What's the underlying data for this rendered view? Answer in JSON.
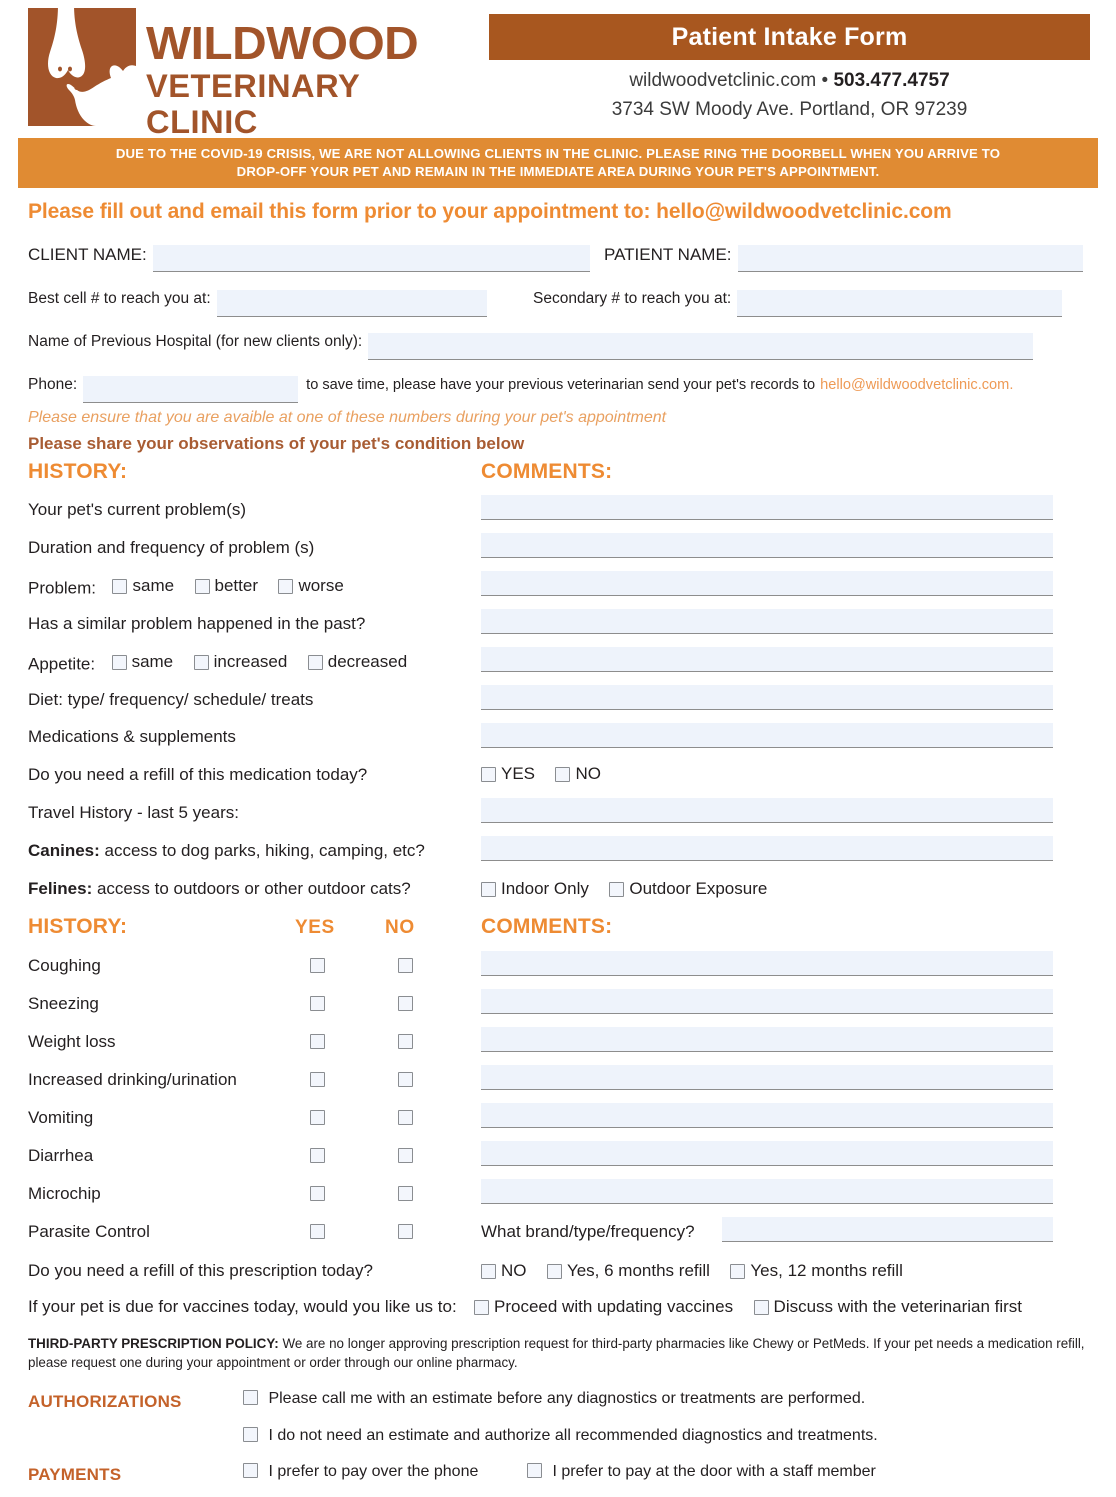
{
  "brand": {
    "name_line1": "WILDWOOD",
    "name_line2": "VETERINARY CLINIC",
    "primary_brown": "#a2542a",
    "banner_orange": "#e08b33",
    "accent_orange": "#ee8b33"
  },
  "header": {
    "title": "Patient Intake Form",
    "website": "wildwoodvetclinic.com",
    "separator": "•",
    "phone": "503.477.4757",
    "address": "3734 SW Moody Ave. Portland, OR 97239"
  },
  "covid_banner": {
    "line1": "DUE TO THE COVID-19 CRISIS, WE ARE NOT ALLOWING CLIENTS IN THE CLINIC. PLEASE RING THE DOORBELL WHEN YOU ARRIVE TO",
    "line2": "DROP-OFF YOUR PET AND REMAIN IN THE IMMEDIATE AREA DURING YOUR PET'S APPOINTMENT."
  },
  "email_notice": "Please fill out and email this form prior to your appointment to: hello@wildwoodvetclinic.com",
  "top_fields": {
    "client_name": "CLIENT NAME:",
    "patient_name": "PATIENT NAME:",
    "best_cell": "Best cell # to reach you at:",
    "secondary": "Secondary # to reach you at:",
    "previous_hospital": "Name of Previous Hospital (for new clients only):",
    "phone_label": "Phone:",
    "phone_tail": "to save time, please have your previous veterinarian send your pet's records to",
    "records_email": "hello@wildwoodvetclinic.com.",
    "ensure_note": "Please ensure that you are avaible at one of these numbers during your pet's appointment",
    "observations": "Please share your observations of your pet's condition below"
  },
  "section1": {
    "history_heading": "HISTORY:",
    "comments_heading": "COMMENTS:",
    "rows": [
      {
        "label": "Your pet's current problem(s)",
        "type": "comment"
      },
      {
        "label": "Duration and frequency of problem (s)",
        "type": "comment"
      },
      {
        "label": "Problem:",
        "type": "choices",
        "options": [
          "same",
          "better",
          "worse"
        ]
      },
      {
        "label": "Has a similar problem happened in the past?",
        "type": "comment"
      },
      {
        "label": "Appetite:",
        "type": "choices",
        "options": [
          "same",
          "increased",
          "decreased"
        ]
      },
      {
        "label": "Diet:  type/ frequency/ schedule/ treats",
        "type": "comment"
      },
      {
        "label": "Medications & supplements",
        "type": "comment"
      },
      {
        "label": "Do you need a refill of this medication today?",
        "type": "yesno",
        "options": [
          "YES",
          "NO"
        ]
      },
      {
        "label": "Travel History - last 5 years:",
        "type": "comment"
      },
      {
        "label_bold": "Canines:",
        "label": " access to dog parks, hiking, camping, etc?",
        "type": "comment"
      },
      {
        "label_bold": "Felines:",
        "label": " access to outdoors or other outdoor cats?",
        "type": "choices",
        "options": [
          "Indoor Only",
          "Outdoor Exposure"
        ]
      }
    ]
  },
  "section2": {
    "history_heading": "HISTORY:",
    "yes_heading": "YES",
    "no_heading": "NO",
    "comments_heading": "COMMENTS:",
    "rows": [
      {
        "label": "Coughing"
      },
      {
        "label": "Sneezing"
      },
      {
        "label": "Weight loss"
      },
      {
        "label": "Increased drinking/urination"
      },
      {
        "label": "Vomiting"
      },
      {
        "label": "Diarrhea"
      },
      {
        "label": "Microchip"
      },
      {
        "label": "Parasite Control",
        "comment_prefix": "What brand/type/frequency?"
      }
    ],
    "refill_question": "Do you need a refill of this prescription today?",
    "refill_options": [
      "NO",
      "Yes, 6 months refill",
      "Yes, 12 months refill"
    ],
    "vaccine_question": "If your pet is due for vaccines today, would you like us to:",
    "vaccine_options": [
      "Proceed with updating vaccines",
      "Discuss with the veterinarian first"
    ]
  },
  "policy": {
    "title": "THIRD-PARTY PRESCRIPTION POLICY:",
    "body": " We are no longer approving prescription request for third-party pharmacies like Chewy or PetMeds. If your pet needs a medication refill, please request one during your appointment or order through our online pharmacy."
  },
  "authorizations": {
    "label": "AUTHORIZATIONS",
    "options": [
      "Please call me with an estimate before any diagnostics or treatments are performed.",
      "I do not need an estimate and authorize all recommended diagnostics and treatments."
    ]
  },
  "payments": {
    "label": "PAYMENTS",
    "options": [
      "I prefer to pay over the phone",
      "I prefer to pay at the door with a staff member"
    ]
  }
}
